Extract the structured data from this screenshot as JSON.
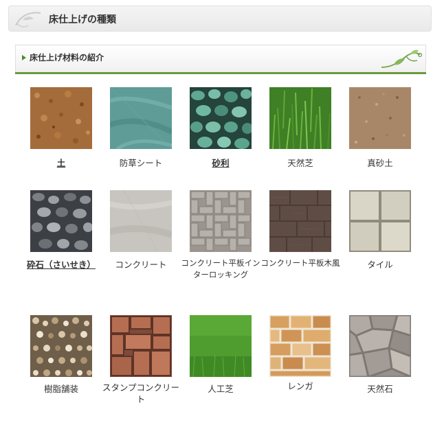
{
  "header": {
    "title": "床仕上げの種類"
  },
  "section": {
    "title": "床仕上げ材料の紹介"
  },
  "materials": [
    {
      "label": "土"
    },
    {
      "label": "防草シート"
    },
    {
      "label": "砂利"
    },
    {
      "label": "天然芝"
    },
    {
      "label": "真砂土"
    },
    {
      "label": "砕石（さいせき）"
    },
    {
      "label": "コンクリート"
    },
    {
      "label": "コンクリート平板インターロッキング"
    },
    {
      "label": "コンクリート平板木風"
    },
    {
      "label": "タイル"
    },
    {
      "label": "樹脂舗装"
    },
    {
      "label": "スタンプコンクリート"
    },
    {
      "label": "人工芝"
    },
    {
      "label": "レンガ"
    },
    {
      "label": "天然石"
    }
  ]
}
